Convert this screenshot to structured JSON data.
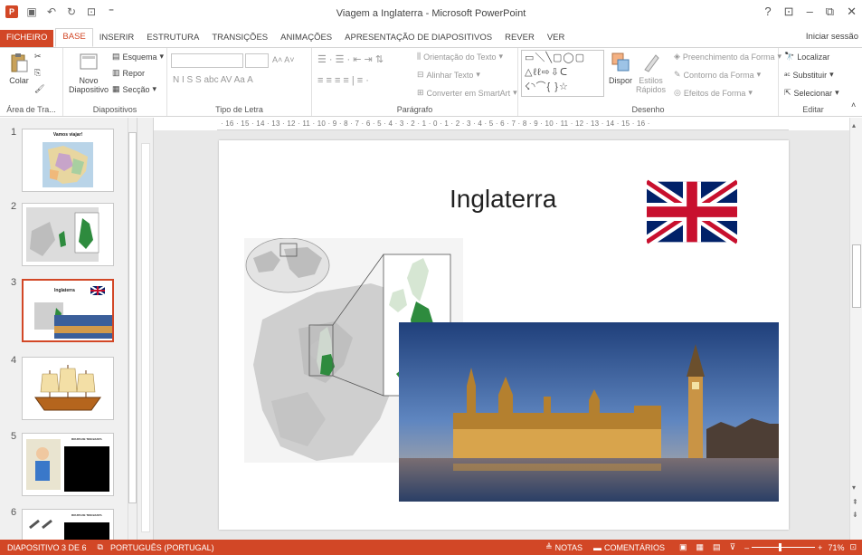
{
  "window": {
    "title": "Viagem a Inglaterra - Microsoft PowerPoint",
    "help": "?",
    "signin": "Iniciar sessão"
  },
  "tabs": [
    "FICHEIRO",
    "BASE",
    "INSERIR",
    "ESTRUTURA",
    "TRANSIÇÕES",
    "ANIMAÇÕES",
    "APRESENTAÇÃO DE DIAPOSITIVOS",
    "REVER",
    "VER"
  ],
  "ribbon": {
    "clipboard": {
      "paste": "Colar",
      "label": "Área de Tra..."
    },
    "slides": {
      "new": "Novo",
      "new2": "Diapositivo",
      "layout": "Esquema",
      "reset": "Repor",
      "section": "Secção",
      "label": "Diapositivos"
    },
    "font": {
      "label": "Tipo de Letra",
      "row2": "N  I  S  S  abc  AV  Aa  A"
    },
    "paragraph": {
      "dir": "Orientação do Texto",
      "align": "Alinhar Texto",
      "smartart": "Converter em SmartArt",
      "label": "Parágrafo"
    },
    "drawing": {
      "arrange": "Dispor",
      "styles": "Estilos",
      "styles2": "Rápidos",
      "fill": "Preenchimento da Forma",
      "outline": "Contorno da Forma",
      "effects": "Efeitos de Forma",
      "label": "Desenho"
    },
    "editing": {
      "find": "Localizar",
      "replace": "Substituir",
      "select": "Selecionar",
      "label": "Editar"
    }
  },
  "thumbnails": [
    {
      "num": "1",
      "title": "Vamos viajar!"
    },
    {
      "num": "2",
      "title": ""
    },
    {
      "num": "3",
      "title": "Inglaterra"
    },
    {
      "num": "4",
      "title": ""
    },
    {
      "num": "5",
      "title": "ROUPA DE TEM BASTA"
    },
    {
      "num": "6",
      "title": "ROUPA DE TEM BASTA"
    }
  ],
  "ruler": {
    "h": "· 16 · 15 · 14 · 13 · 12 · 11 · 10 · 9 · 8 · 7 · 6 · 5 · 4 · 3 · 2 · 1 · 0 · 1 · 2 · 3 · 4 · 5 · 6 · 7 · 8 · 9 · 10 · 11 · 12 · 13 · 14 · 15 · 16 ·"
  },
  "slide": {
    "title": "Inglaterra"
  },
  "status": {
    "slide": "DIAPOSITIVO 3 DE 6",
    "lang": "PORTUGUÊS (PORTUGAL)",
    "notes": "NOTAS",
    "comments": "COMENTÁRIOS",
    "zoom": "71%"
  },
  "colors": {
    "accent": "#d24726",
    "england_green": "#2e8b3e",
    "uk_flag_blue": "#012169",
    "uk_flag_red": "#c8102e"
  }
}
